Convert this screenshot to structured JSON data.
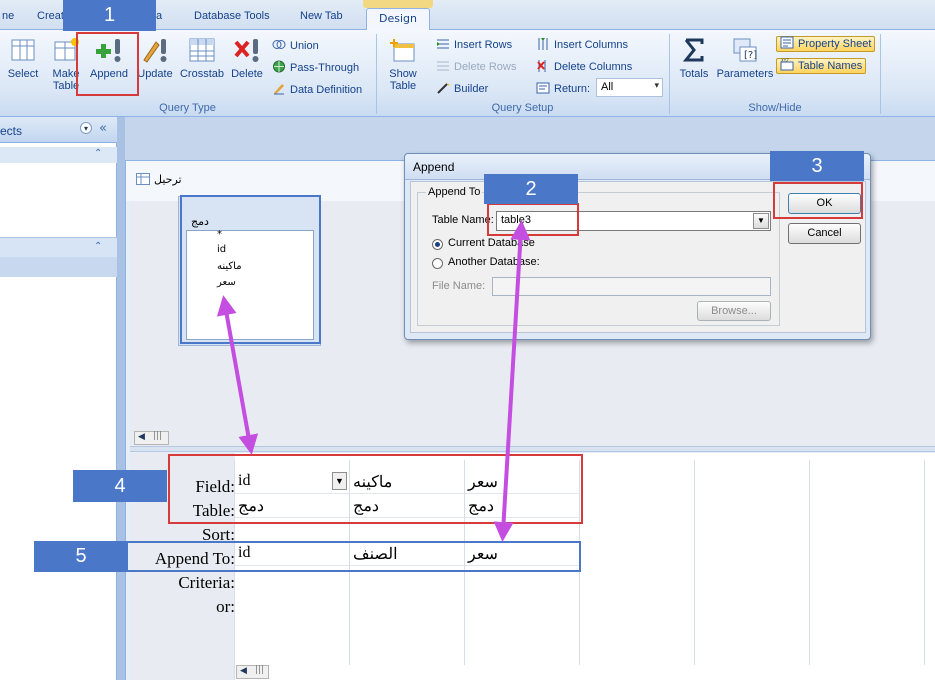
{
  "ribbon": {
    "tabs": [
      "ne",
      "Creat",
      "ta",
      "Database Tools",
      "New Tab",
      "Design"
    ],
    "groups": {
      "query_type": {
        "label": "Query Type",
        "buttons": [
          "Select",
          "Make Table",
          "Append",
          "Update",
          "Crosstab",
          "Delete"
        ],
        "small": [
          "Union",
          "Pass-Through",
          "Data Definition"
        ]
      },
      "query_setup": {
        "label": "Query Setup",
        "show_table": "Show Table",
        "small_left": [
          "Insert Rows",
          "Delete Rows",
          "Builder"
        ],
        "small_right": [
          "Insert Columns",
          "Delete Columns"
        ],
        "return_label": "Return:",
        "return_value": "All"
      },
      "totals": "Totals",
      "parameters": "Parameters",
      "show_hide": {
        "label": "Show/Hide",
        "property_sheet": "Property Sheet",
        "table_names": "Table Names"
      }
    }
  },
  "nav": {
    "title": "ects"
  },
  "query": {
    "title": "ترحيل",
    "table": {
      "name": "دمج",
      "fields": [
        "*",
        "id",
        "ماكينه",
        "سعر"
      ]
    },
    "row_labels": [
      "Field:",
      "Table:",
      "Sort:",
      "Append To:",
      "Criteria:",
      "or:"
    ],
    "columns": [
      {
        "field": "id",
        "table": "دمج",
        "append_to": "id"
      },
      {
        "field": "ماكينه",
        "table": "دمج",
        "append_to": "الصنف"
      },
      {
        "field": "سعر",
        "table": "دمج",
        "append_to": "سعر"
      }
    ]
  },
  "dialog": {
    "title": "Append",
    "group_label": "Append To",
    "table_name_label": "Table Name:",
    "table_name_value": "table3",
    "current_db": "Current Database",
    "another_db": "Another Database:",
    "file_name_label": "File Name:",
    "browse": "Browse...",
    "ok": "OK",
    "cancel": "Cancel"
  },
  "callouts": [
    "1",
    "2",
    "3",
    "4",
    "5"
  ]
}
